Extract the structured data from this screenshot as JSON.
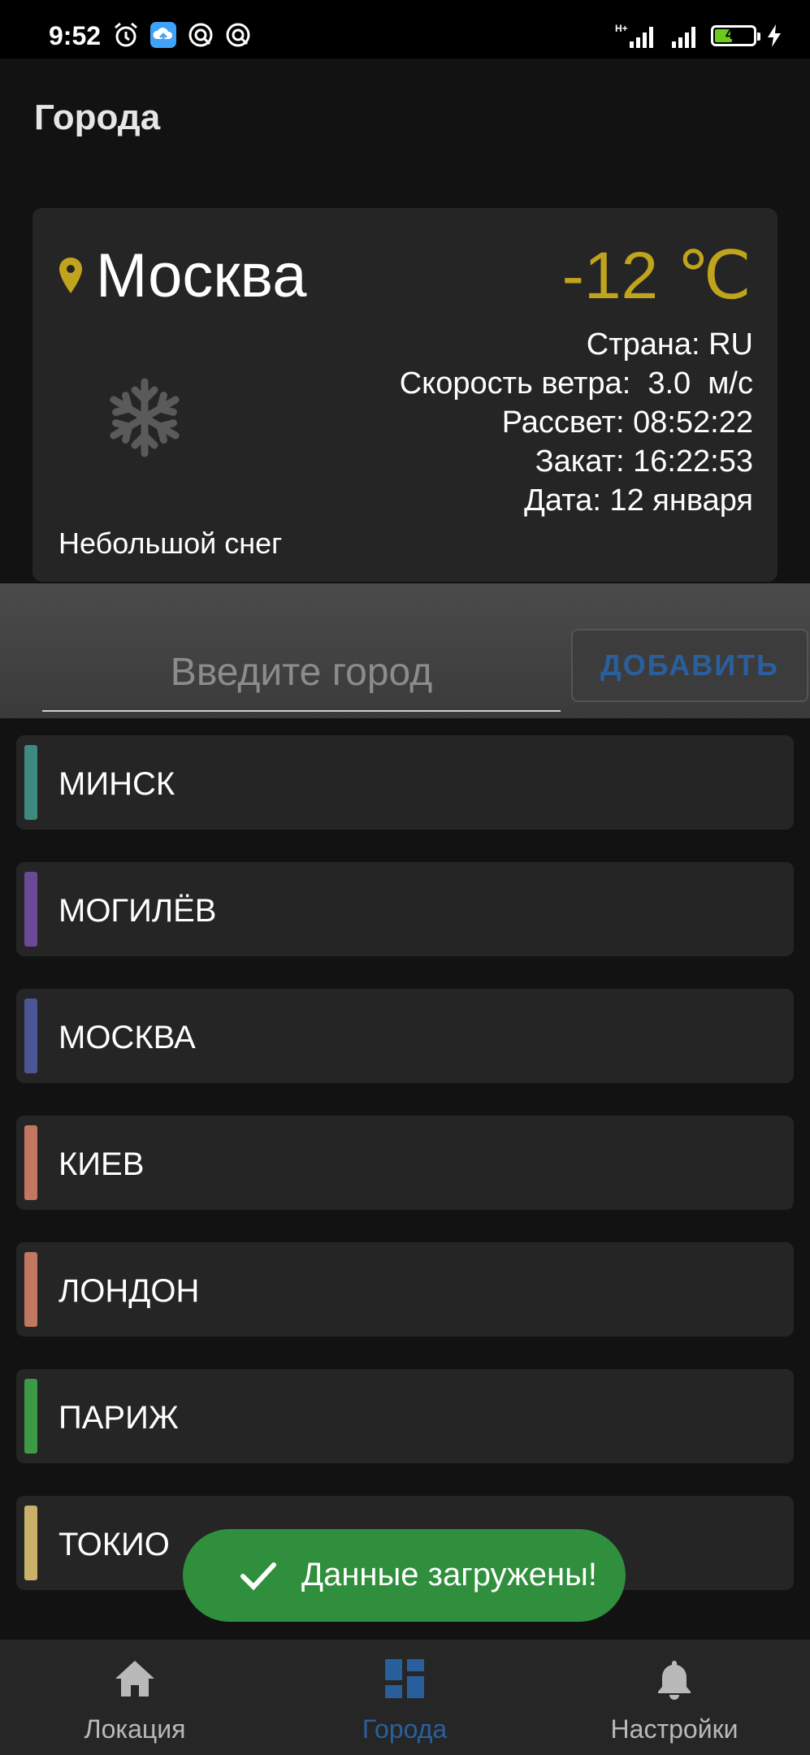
{
  "status_bar": {
    "time": "9:52",
    "network": "H+",
    "battery": "45",
    "battery_level_percent": 45,
    "icons": [
      "alarm-icon",
      "cloud-upload-icon",
      "sync-icon",
      "sync-icon",
      "signal-icon",
      "signal-icon",
      "battery-icon",
      "charging-icon"
    ]
  },
  "page_title": "Города",
  "weather": {
    "city": "Москва",
    "temperature": "-12 ℃",
    "country": "Страна: RU",
    "wind": "Скорость ветра:  3.0  м/с",
    "sunrise": "Рассвет: 08:52:22",
    "sunset": "Закат: 16:22:53",
    "date": "Дата: 12 января",
    "description": "Небольшой снег",
    "icon": "snowflake-icon",
    "temp_color": "#c1a41d"
  },
  "add_city": {
    "placeholder": "Введите город",
    "value": "",
    "button_label": "ДОБАВИТЬ",
    "button_color": "#2a5f9e"
  },
  "cities": [
    {
      "name": "МИНСК",
      "color": "#3e8a7e"
    },
    {
      "name": "МОГИЛЁВ",
      "color": "#6a4a96"
    },
    {
      "name": "МОСКВА",
      "color": "#4a5695"
    },
    {
      "name": "КИЕВ",
      "color": "#c27860"
    },
    {
      "name": "ЛОНДОН",
      "color": "#c27860"
    },
    {
      "name": "ПАРИЖ",
      "color": "#3c9a46"
    },
    {
      "name": "ТОКИО",
      "color": "#c9b16a"
    }
  ],
  "toast": {
    "text": "Данные загружены!",
    "color": "#2f8f3c",
    "icon": "check-icon"
  },
  "bottom_nav": {
    "items": [
      {
        "label": "Локация",
        "icon": "home-icon",
        "active": false
      },
      {
        "label": "Города",
        "icon": "dashboard-icon",
        "active": true
      },
      {
        "label": "Настройки",
        "icon": "bell-icon",
        "active": false
      }
    ],
    "active_color": "#2a5f9e"
  }
}
